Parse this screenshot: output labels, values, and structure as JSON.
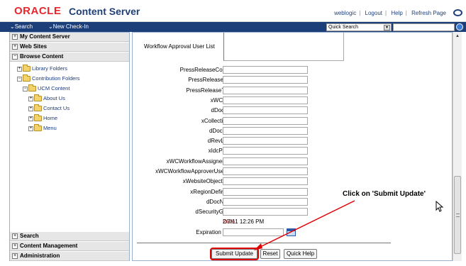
{
  "header": {
    "logo": "ORACLE",
    "product": "Content Server",
    "nav": [
      "weblogic",
      "Logout",
      "Help",
      "Refresh Page"
    ]
  },
  "toolbar": {
    "search": "Search",
    "new_checkin": "New Check-In",
    "quick_search_selected": "Quick Search"
  },
  "sidebar": {
    "sections_top": [
      "My Content Server",
      "Web Sites",
      "Browse Content"
    ],
    "tree": [
      {
        "label": "Library Folders"
      },
      {
        "label": "Contribution Folders"
      },
      {
        "label": "UCM Content"
      },
      {
        "label": "About Us"
      },
      {
        "label": "Contact Us"
      },
      {
        "label": "Home"
      },
      {
        "label": "Menu"
      }
    ],
    "sections_bottom": [
      "Search",
      "Content Management",
      "Administration"
    ]
  },
  "form": {
    "workflow_label": "Workflow Approval User List",
    "fields": [
      {
        "label": "PressReleaseContact",
        "value": ""
      },
      {
        "label": "PressReleaseLOB",
        "value": ""
      },
      {
        "label": "PressReleaseTopic",
        "value": ""
      },
      {
        "label": "xWCTags",
        "value": ""
      },
      {
        "label": "dDocTitle",
        "value": ""
      },
      {
        "label": "xCollectionID",
        "value": ""
      },
      {
        "label": "dDocType",
        "value": ""
      },
      {
        "label": "dRevLabel",
        "value": ""
      },
      {
        "label": "xIdcProfile",
        "value": ""
      },
      {
        "label": "xWCWorkflowAssignement",
        "value": ""
      },
      {
        "label": "xWCWorkflowApproverUserList",
        "value": ""
      },
      {
        "label": "xWebsiteObjectType",
        "value": ""
      },
      {
        "label": "xRegionDefinition",
        "value": ""
      },
      {
        "label": "dDocName",
        "value": ""
      },
      {
        "label": "dSecurityGroup",
        "value": ""
      }
    ],
    "date_label": "Date",
    "date_value": "2/7/11 12:26 PM",
    "expiration_label": "Expiration Date",
    "buttons": {
      "submit": "Submit Update",
      "reset": "Reset",
      "quick_help": "Quick Help"
    }
  },
  "annotation": {
    "text": "Click on 'Submit Update'",
    "color": "#e00000"
  }
}
